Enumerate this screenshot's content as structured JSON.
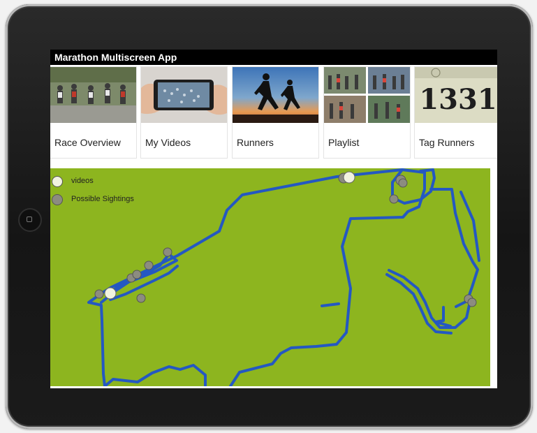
{
  "app": {
    "title": "Marathon Multiscreen App"
  },
  "tiles": [
    {
      "label": "Race Overview",
      "image": "marathon-runners-photo"
    },
    {
      "label": "My Videos",
      "image": "phone-recording-photo"
    },
    {
      "label": "Runners",
      "image": "runners-silhouette-sunset-photo"
    },
    {
      "label": "Playlist",
      "image": "race-photo-collage"
    },
    {
      "label": "Tag Runners",
      "image": "race-bib-number-photo",
      "bib_number": "1331"
    }
  ],
  "map": {
    "legend": [
      {
        "label": "videos",
        "color": "#f1f3df"
      },
      {
        "label": "Possible Sightings",
        "color": "#8c8c80"
      }
    ],
    "background_color": "#8db51f",
    "route_color": "#2458c2"
  }
}
